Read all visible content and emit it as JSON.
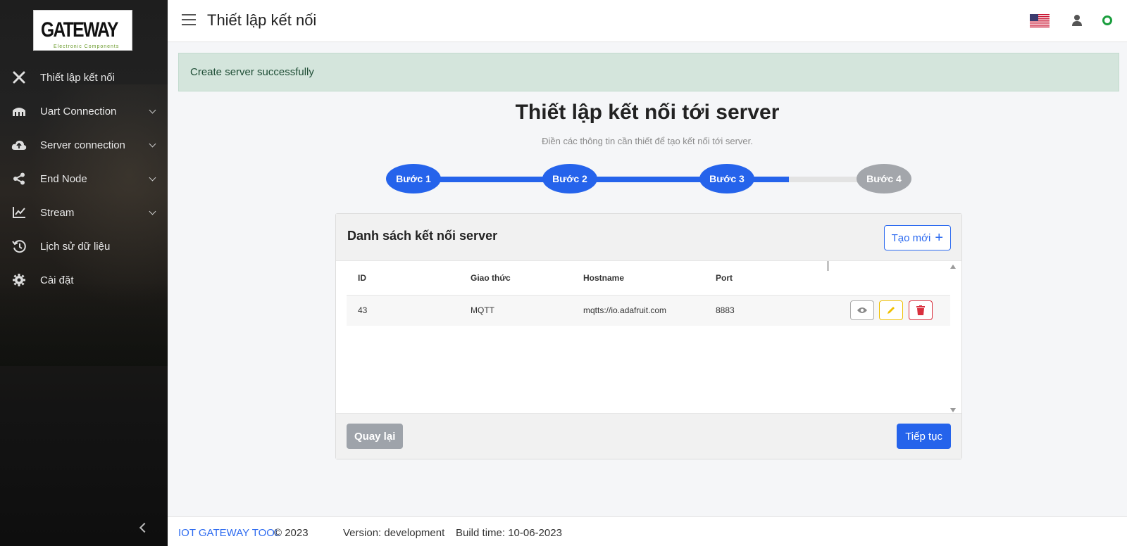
{
  "logo": {
    "brand": "GATEWAY",
    "tagline": "Electronic Components"
  },
  "sidebar": {
    "items": [
      {
        "label": "Thiết lập kết nối",
        "icon": "tools-icon"
      },
      {
        "label": "Uart Connection",
        "icon": "uart-icon",
        "expandable": true
      },
      {
        "label": "Server connection",
        "icon": "cloud-upload-icon",
        "expandable": true
      },
      {
        "label": "End Node",
        "icon": "share-icon",
        "expandable": true
      },
      {
        "label": "Stream",
        "icon": "chart-line-icon",
        "expandable": true
      },
      {
        "label": "Lịch sử dữ liệu",
        "icon": "history-icon"
      },
      {
        "label": "Cài đặt",
        "icon": "gear-icon"
      }
    ]
  },
  "header": {
    "title": "Thiết lập kết nối"
  },
  "alert": {
    "message": "Create server successfully"
  },
  "page": {
    "title": "Thiết lập kết nối tới server",
    "subtitle": "Điền các thông tin cần thiết để tạo kết nối tới server."
  },
  "stepper": {
    "steps": [
      "Bước 1",
      "Bước 2",
      "Bước 3",
      "Bước 4"
    ],
    "active_color": "#2563eb",
    "inactive_color": "#a3a6ab"
  },
  "card": {
    "title": "Danh sách kết nối server",
    "new_button": "Tạo mới",
    "columns": [
      "ID",
      "Giao thức",
      "Hostname",
      "Port"
    ],
    "rows": [
      {
        "id": "43",
        "protocol": "MQTT",
        "hostname": "mqtts://io.adafruit.com",
        "port": "8883"
      }
    ],
    "back_button": "Quay lại",
    "next_button": "Tiếp tục"
  },
  "footer": {
    "brand": "IOT GATEWAY TOOL",
    "copyright": "© 2023",
    "version": "Version: development",
    "build": "Build time: 10-06-2023"
  }
}
